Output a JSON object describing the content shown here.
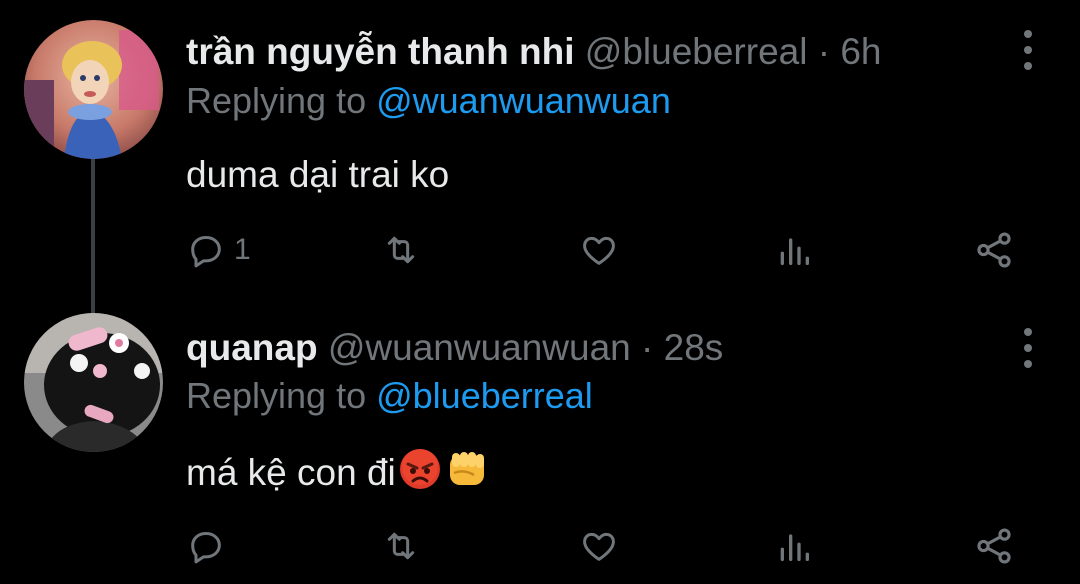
{
  "tweets": [
    {
      "author_name": "trần nguyễn thanh nhi",
      "handle": "@blueberreal",
      "separator": "·",
      "time": "6h",
      "replying_prefix": "Replying to ",
      "replying_to": "@wuanwuanwuan",
      "text": "duma dại trai ko",
      "reply_count": "1",
      "icons": [
        "reply-icon",
        "retweet-icon",
        "like-icon",
        "views-icon",
        "share-icon",
        "more-icon"
      ]
    },
    {
      "author_name": "quanap",
      "handle": "@wuanwuanwuan",
      "separator": "·",
      "time": "28s",
      "replying_prefix": "Replying to ",
      "replying_to": "@blueberreal",
      "text": "má kệ con đi",
      "emojis": [
        "angry-face-emoji",
        "fist-emoji"
      ],
      "reply_count": "",
      "icons": [
        "reply-icon",
        "retweet-icon",
        "like-icon",
        "views-icon",
        "share-icon",
        "more-icon"
      ]
    }
  ],
  "colors": {
    "background": "#000000",
    "text_primary": "#e7e9ea",
    "text_secondary": "#71767b",
    "mention": "#1d9bf0",
    "thread_line": "#3b3f43"
  }
}
